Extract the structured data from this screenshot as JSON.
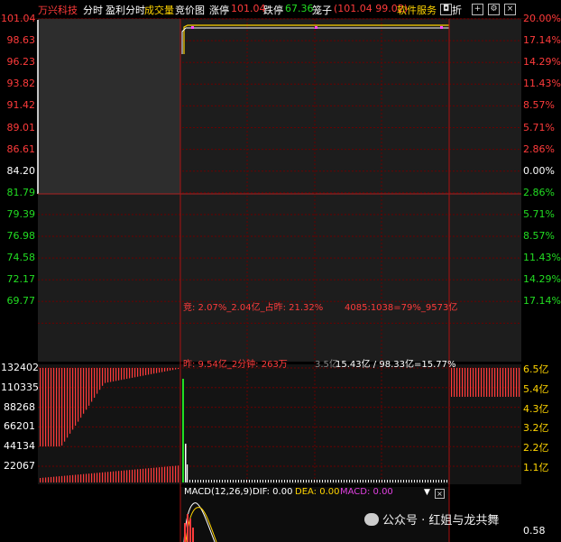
{
  "header": {
    "stock_name": "万兴科技",
    "tab_intraday": "分时",
    "tab_profit": "盈利分时",
    "tab_volume": "成交量",
    "tab_auction": "竞价图",
    "limit_up_label": "涨停",
    "limit_up_value": "101.04",
    "limit_down_label": "跌停",
    "limit_down_value": "67.36",
    "chip_label": "笼子",
    "chip_value": "(101.04 99.02)",
    "software_label": "软件服务",
    "analysis_label": "折"
  },
  "price_axis_left": [
    "101.04",
    "98.63",
    "96.23",
    "93.82",
    "91.42",
    "89.01",
    "86.61",
    "84.20",
    "81.79",
    "79.39",
    "76.98",
    "74.58",
    "72.17",
    "69.77"
  ],
  "price_axis_right": [
    "20.00%",
    "17.14%",
    "14.29%",
    "11.43%",
    "8.57%",
    "5.71%",
    "2.86%",
    "0.00%",
    "2.86%",
    "5.71%",
    "8.57%",
    "11.43%",
    "14.29%",
    "17.14%"
  ],
  "volume_axis_left": [
    "132402",
    "110335",
    "88268",
    "66201",
    "44134",
    "22067"
  ],
  "volume_axis_right": [
    "6.5亿",
    "5.4亿",
    "4.3亿",
    "3.2亿",
    "2.2亿",
    "1.1亿"
  ],
  "annotations": {
    "auction": "竞: 2.07%_2.04亿_占昨: 21.32%",
    "ratio": "4085:1038=79%_9573亿",
    "yesterday": "昨: 9.54亿_2分钟: 263万",
    "mid_small": "3.5亿",
    "turnover": "15.43亿 / 98.33亿=15.77%"
  },
  "macd": {
    "title": "MACD(12,26,9)",
    "dif_label": "DIF: 0.00",
    "dea_label": "DEA: 0.00",
    "macd_label": "MACD: 0.00",
    "axis_value": "0.58"
  },
  "watermark": {
    "text": "公众号 · 红姐与龙共舞"
  },
  "colors": {
    "up": "#ff3b3b",
    "down": "#22dd22",
    "price_line": "#ffd400",
    "grid": "#6a0000",
    "panel_bg": "#1d1d1d"
  }
}
